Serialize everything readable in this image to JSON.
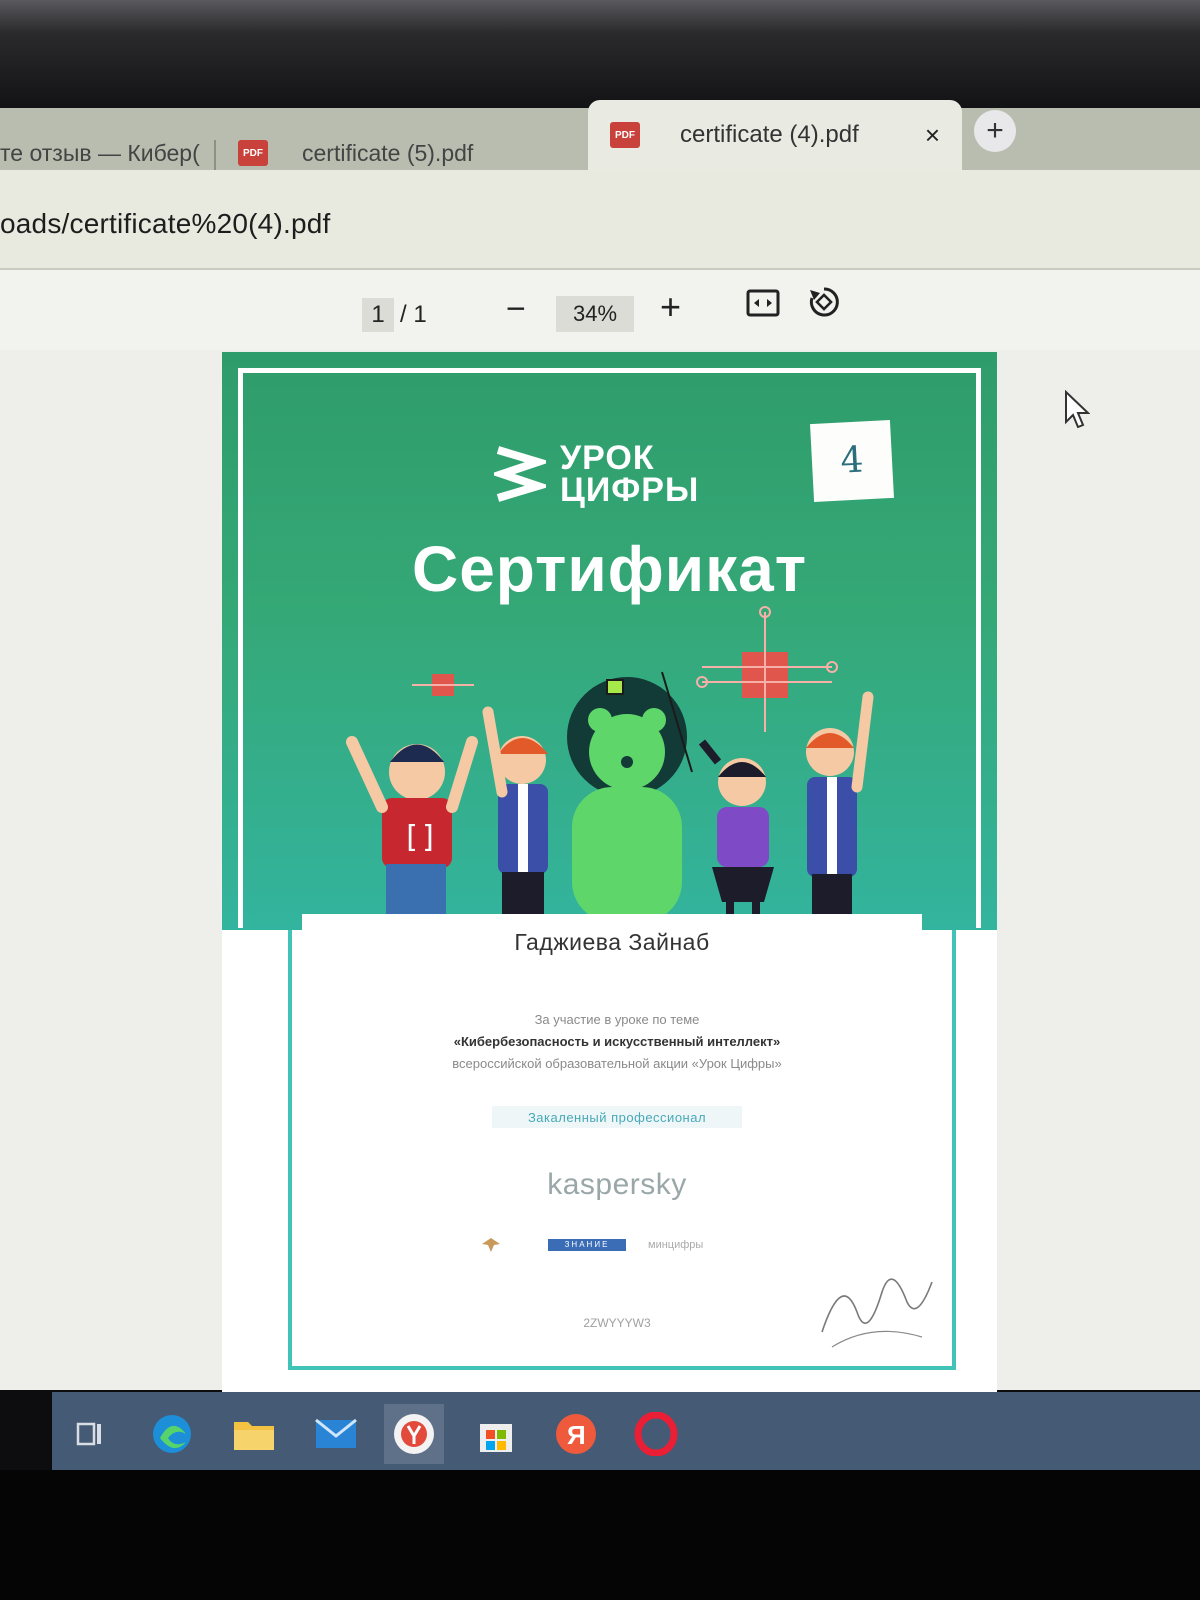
{
  "browser": {
    "tabs": [
      {
        "label": "те отзыв — Кибер("
      },
      {
        "label": "certificate (5).pdf",
        "icon": "pdf-icon"
      },
      {
        "label": "certificate (4).pdf",
        "icon": "pdf-icon",
        "active": true
      }
    ],
    "pdf_badge": "PDF",
    "close_glyph": "×",
    "new_tab_glyph": "+",
    "address": "oads/certificate%20(4).pdf"
  },
  "pdf_toolbar": {
    "page_current": "1",
    "page_total": "/ 1",
    "zoom_minus": "−",
    "zoom": "34%",
    "zoom_plus": "+"
  },
  "certificate": {
    "logo_line1": "УРОК",
    "logo_line2": "ЦИФРЫ",
    "handwritten_number": "4",
    "title": "Сертификат",
    "recipient": "Гаджиева Зайнаб",
    "line1": "За участие в уроке по теме",
    "line2": "«Кибербезопасность и искусственный интеллект»",
    "line3": "всероссийской образовательной акции «Урок Цифры»",
    "level": "Закаленный профессионал",
    "sponsor": "kaspersky",
    "partner1": "ЗНАНИЕ",
    "partner2": "минцифры",
    "code": "2ZWYYYW3"
  },
  "colors": {
    "cert_green": "#35a877",
    "cert_teal": "#42c3b8",
    "taskbar": "#455a74"
  },
  "taskbar": {
    "icons": [
      "task-view-icon",
      "edge-icon",
      "file-explorer-icon",
      "mail-icon",
      "yandex-browser-icon",
      "store-icon",
      "yandex-icon",
      "opera-icon"
    ]
  }
}
